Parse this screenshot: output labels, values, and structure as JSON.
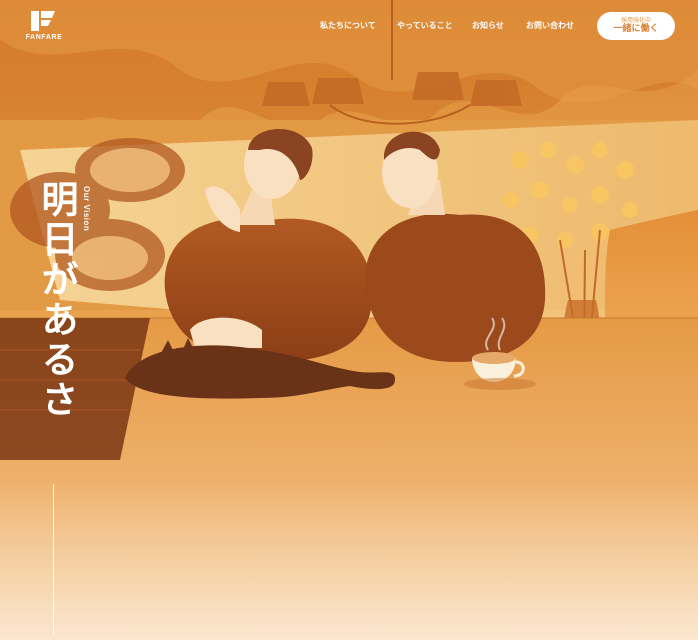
{
  "brand": {
    "name": "FANFARE"
  },
  "nav": {
    "items": [
      {
        "label": "私たちについて"
      },
      {
        "label": "やっていること"
      },
      {
        "label": "お知らせ"
      },
      {
        "label": "お問い合わせ"
      }
    ]
  },
  "cta": {
    "sub_label": "採用強化中",
    "label": "一緒に働く"
  },
  "hero": {
    "vision_label": "Our Vision",
    "vision_title": "明日があるさ"
  },
  "colors": {
    "accent": "#e9a24a",
    "cta_text": "#d9843a",
    "dark_band": "#6a2e12"
  },
  "icons": {
    "logo": "fanfare-logo-icon"
  }
}
